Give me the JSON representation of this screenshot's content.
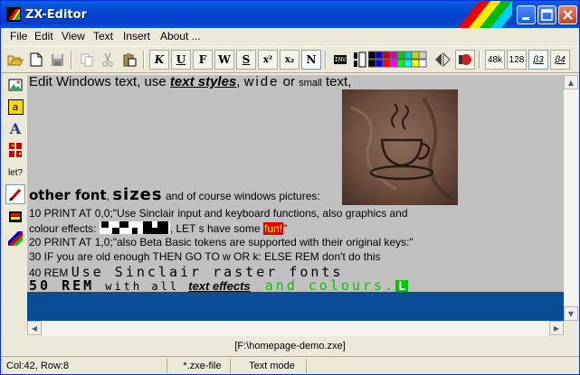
{
  "window": {
    "title": "ZX-Editor"
  },
  "menus": [
    "File",
    "Edit",
    "View",
    "Text",
    "Insert",
    "About ..."
  ],
  "toolbar": {
    "italic": "K",
    "underline": "U",
    "bold": "F",
    "wide": "W",
    "shadow": "S",
    "superscript": "x²",
    "subscript": "x₂",
    "normal": "N",
    "inv": "INV",
    "mode_48k": "48k",
    "mode_128": "128",
    "mode_b3": "β3",
    "mode_b4": "β4"
  },
  "sidebar_tools": [
    {
      "icon": "image-icon"
    },
    {
      "icon": "text-frame-icon",
      "label": "a"
    },
    {
      "icon": "font-icon",
      "label": "A"
    },
    {
      "icon": "grid-icon"
    },
    {
      "icon": "let-help-icon",
      "label": "let?"
    },
    {
      "icon": "pen-icon"
    },
    {
      "icon": "screen-icon"
    },
    {
      "icon": "palette-icon"
    }
  ],
  "editor": {
    "line1_a": "Edit Windows text, use ",
    "line1_styles": "text styles",
    "line1_b": ", ",
    "line1_wide": "wide",
    "line1_c": " or ",
    "line1_small": "small",
    "line1_d": " text,",
    "line2_other": "other font",
    "line2_comma": ", ",
    "line2_sizes": "sizes",
    "line2_rest": " and of course windows pictures:",
    "line3": "10 PRINT AT 0,0;\"Use Sinclair input and keyboard functions, also graphics and",
    "line4_a": "colour effects:",
    "line4_b": ", LET s have some ",
    "line4_fun": "fun!",
    "line4_c": "\"",
    "line5": "20 PRINT AT 1,0;\"also Beta Basic tokens are supported with their original keys:\"",
    "line6": "30 IF you are old enough THEN GO TO w OR k: ELSE REM don't do this",
    "line7_a": "40 REM ",
    "line7_b": "Use  Sinclair  raster  fonts",
    "line8_a": "50 REM ",
    "line8_b": "with all ",
    "line8_c": "text effects",
    "line8_d": "and colours.",
    "line8_cursor": "L"
  },
  "path": "[F:\\homepage-demo.zxe]",
  "status": {
    "position": "Col:42, Row:8",
    "filetype": "*.zxe-file",
    "mode": "Text mode"
  }
}
